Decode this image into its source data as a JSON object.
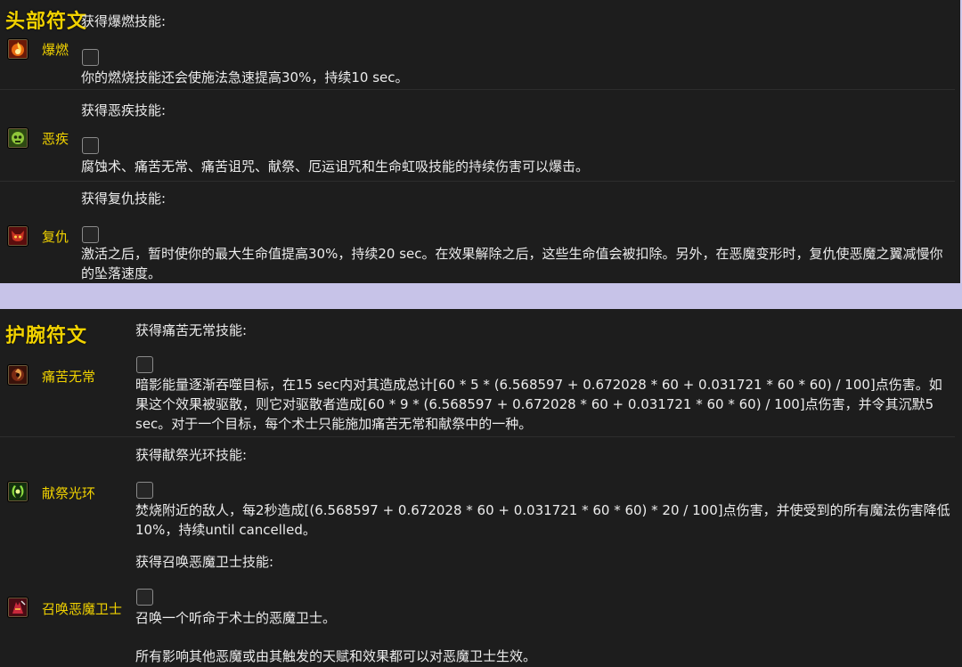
{
  "head_section": {
    "title": "头部符文",
    "runes": [
      {
        "name": "爆燃",
        "icon": "fire-burst-icon",
        "gain": "获得爆燃技能:",
        "desc": "你的燃烧技能还会使施法急速提高30%，持续10 sec。"
      },
      {
        "name": "恶疾",
        "icon": "plague-skull-icon",
        "gain": "获得恶疾技能:",
        "desc": "腐蚀术、痛苦无常、痛苦诅咒、献祭、厄运诅咒和生命虹吸技能的持续伤害可以爆击。"
      },
      {
        "name": "复仇",
        "icon": "demon-face-icon",
        "gain": "获得复仇技能:",
        "desc": "激活之后，暂时使你的最大生命值提高30%，持续20 sec。在效果解除之后，这些生命值会被扣除。另外，在恶魔变形时，复仇使恶魔之翼减慢你的坠落速度。"
      }
    ]
  },
  "wrist_section": {
    "title": "护腕符文",
    "runes": [
      {
        "name": "痛苦无常",
        "icon": "shadow-swirl-icon",
        "gain": "获得痛苦无常技能:",
        "desc": "暗影能量逐渐吞噬目标，在15 sec内对其造成总计[60 * 5 * (6.568597 + 0.672028 * 60 + 0.031721 * 60 * 60) / 100]点伤害。如果这个效果被驱散，则它对驱散者造成[60 * 9 * (6.568597 + 0.672028 * 60 + 0.031721 * 60 * 60) / 100]点伤害，并令其沉默5 sec。对于一个目标，每个术士只能施加痛苦无常和献祭中的一种。"
      },
      {
        "name": "献祭光环",
        "icon": "green-aura-icon",
        "gain": "获得献祭光环技能:",
        "desc": "焚烧附近的敌人，每2秒造成[(6.568597 + 0.672028 * 60 + 0.031721 * 60 * 60) * 20 / 100]点伤害，并使受到的所有魔法伤害降低10%，持续until cancelled。"
      },
      {
        "name": "召唤恶魔卫士",
        "icon": "felguard-icon",
        "gain": "获得召唤恶魔卫士技能:",
        "desc": "召唤一个听命于术士的恶魔卫士。",
        "desc2": "所有影响其他恶魔或由其触发的天赋和效果都可以对恶魔卫士生效。"
      }
    ]
  }
}
